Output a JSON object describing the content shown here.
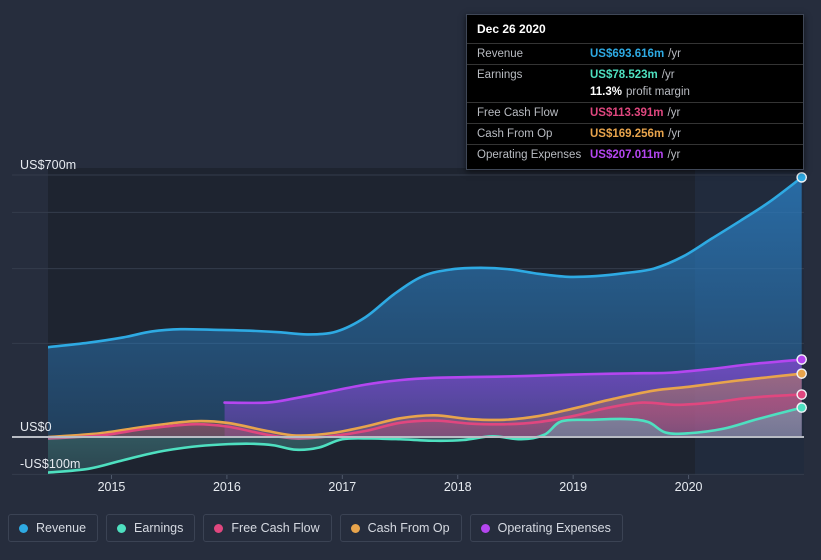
{
  "chart_data": {
    "type": "area",
    "title": "",
    "xlabel": "",
    "ylabel": "",
    "currency": "US$",
    "grid": true,
    "legend_position": "bottom-left",
    "xlim": [
      2014.45,
      2021.0
    ],
    "ylim": [
      -140,
      740
    ],
    "x_tick_labels": [
      "2015",
      "2016",
      "2017",
      "2018",
      "2019",
      "2020"
    ],
    "x_ticks": [
      2015,
      2016,
      2017,
      2018,
      2019,
      2020
    ],
    "y_tick_labels": [
      "US$700m",
      "US$0",
      "-US$100m"
    ],
    "y_ticks": [
      700,
      0,
      -100
    ],
    "gridlines": [
      700,
      600,
      450,
      250,
      0,
      -100
    ],
    "series": [
      {
        "name": "Revenue",
        "color": "#2eaae3",
        "end_value": 693.616,
        "x": [
          2014.45,
          2014.8,
          2015.1,
          2015.35,
          2015.6,
          2015.95,
          2016.2,
          2016.45,
          2016.7,
          2016.95,
          2017.2,
          2017.45,
          2017.7,
          2017.95,
          2018.2,
          2018.45,
          2018.7,
          2018.95,
          2019.2,
          2019.45,
          2019.7,
          2019.95,
          2020.2,
          2020.45,
          2020.7,
          2020.98
        ],
        "values": [
          240,
          252,
          266,
          282,
          288,
          286,
          284,
          280,
          274,
          282,
          320,
          382,
          430,
          448,
          452,
          448,
          436,
          428,
          430,
          438,
          450,
          482,
          530,
          578,
          628,
          693.616
        ]
      },
      {
        "name": "Earnings",
        "color": "#4ee0c0",
        "end_value": 78.523,
        "profit_margin": "11.3%",
        "x": [
          2014.45,
          2014.8,
          2015.1,
          2015.4,
          2015.7,
          2015.95,
          2016.2,
          2016.4,
          2016.6,
          2016.8,
          2017.0,
          2017.25,
          2017.5,
          2017.8,
          2018.05,
          2018.3,
          2018.55,
          2018.75,
          2018.9,
          2019.15,
          2019.45,
          2019.65,
          2019.8,
          2020.0,
          2020.3,
          2020.6,
          2020.98
        ],
        "values": [
          -95,
          -85,
          -62,
          -40,
          -26,
          -20,
          -18,
          -22,
          -34,
          -28,
          -6,
          -4,
          -6,
          -10,
          -8,
          2,
          -6,
          6,
          42,
          46,
          48,
          40,
          12,
          10,
          22,
          48,
          78.523
        ]
      },
      {
        "name": "Free Cash Flow",
        "color": "#e0477f",
        "end_value": 113.391,
        "x": [
          2014.45,
          2014.9,
          2015.3,
          2015.7,
          2016.0,
          2016.35,
          2016.6,
          2016.9,
          2017.2,
          2017.5,
          2017.8,
          2018.1,
          2018.4,
          2018.7,
          2019.0,
          2019.3,
          2019.6,
          2019.9,
          2020.2,
          2020.5,
          2020.75,
          2020.98
        ],
        "values": [
          -4,
          4,
          22,
          34,
          28,
          6,
          -4,
          2,
          16,
          38,
          44,
          36,
          34,
          40,
          56,
          78,
          92,
          86,
          92,
          104,
          110,
          113.391
        ]
      },
      {
        "name": "Cash From Op",
        "color": "#e8a44c",
        "end_value": 169.256,
        "x": [
          2014.45,
          2014.9,
          2015.3,
          2015.7,
          2016.0,
          2016.35,
          2016.6,
          2016.9,
          2017.2,
          2017.5,
          2017.8,
          2018.1,
          2018.4,
          2018.7,
          2019.0,
          2019.35,
          2019.7,
          2020.0,
          2020.35,
          2020.7,
          2020.98
        ],
        "values": [
          0,
          10,
          28,
          42,
          38,
          16,
          4,
          10,
          28,
          50,
          58,
          48,
          46,
          56,
          76,
          102,
          124,
          134,
          148,
          160,
          169.256
        ]
      },
      {
        "name": "Operating Expenses",
        "color": "#b446f0",
        "end_value": 207.011,
        "x": [
          2015.98,
          2016.35,
          2016.6,
          2016.9,
          2017.2,
          2017.5,
          2017.8,
          2018.1,
          2018.45,
          2018.8,
          2019.15,
          2019.5,
          2019.85,
          2020.2,
          2020.55,
          2020.98
        ],
        "values": [
          92,
          92,
          104,
          122,
          140,
          152,
          158,
          160,
          162,
          165,
          168,
          170,
          172,
          182,
          195,
          207.011
        ]
      }
    ]
  },
  "tooltip": {
    "date": "Dec 26 2020",
    "rows": [
      {
        "label": "Revenue",
        "value": "US$693.616m",
        "unit": "/yr",
        "color": "#2eaae3"
      },
      {
        "label": "Earnings",
        "value": "US$78.523m",
        "unit": "/yr",
        "color": "#4ee0c0"
      },
      {
        "label": "",
        "value": "11.3%",
        "unit": "profit margin",
        "color": "#ffffff"
      },
      {
        "label": "Free Cash Flow",
        "value": "US$113.391m",
        "unit": "/yr",
        "color": "#e0477f"
      },
      {
        "label": "Cash From Op",
        "value": "US$169.256m",
        "unit": "/yr",
        "color": "#e8a44c"
      },
      {
        "label": "Operating Expenses",
        "value": "US$207.011m",
        "unit": "/yr",
        "color": "#b446f0"
      }
    ]
  },
  "legend": {
    "items": [
      {
        "label": "Revenue",
        "color": "#2eaae3"
      },
      {
        "label": "Earnings",
        "color": "#4ee0c0"
      },
      {
        "label": "Free Cash Flow",
        "color": "#e0477f"
      },
      {
        "label": "Cash From Op",
        "color": "#e8a44c"
      },
      {
        "label": "Operating Expenses",
        "color": "#b446f0"
      }
    ]
  },
  "axes": {
    "y_labels": [
      {
        "text": "US$700m",
        "value": 700
      },
      {
        "text": "US$0",
        "value": 0
      },
      {
        "text": "-US$100m",
        "value": -100
      }
    ],
    "x_labels": [
      "2015",
      "2016",
      "2017",
      "2018",
      "2019",
      "2020"
    ]
  },
  "colors": {
    "page_background": "#262d3d",
    "plot_background": "#1e2430",
    "forecast_background": "#1b2537",
    "gridline": "#343c4c",
    "zero_line": "#b8bcc4",
    "tooltip_background": "#000000",
    "tooltip_border": "#3f4757"
  }
}
